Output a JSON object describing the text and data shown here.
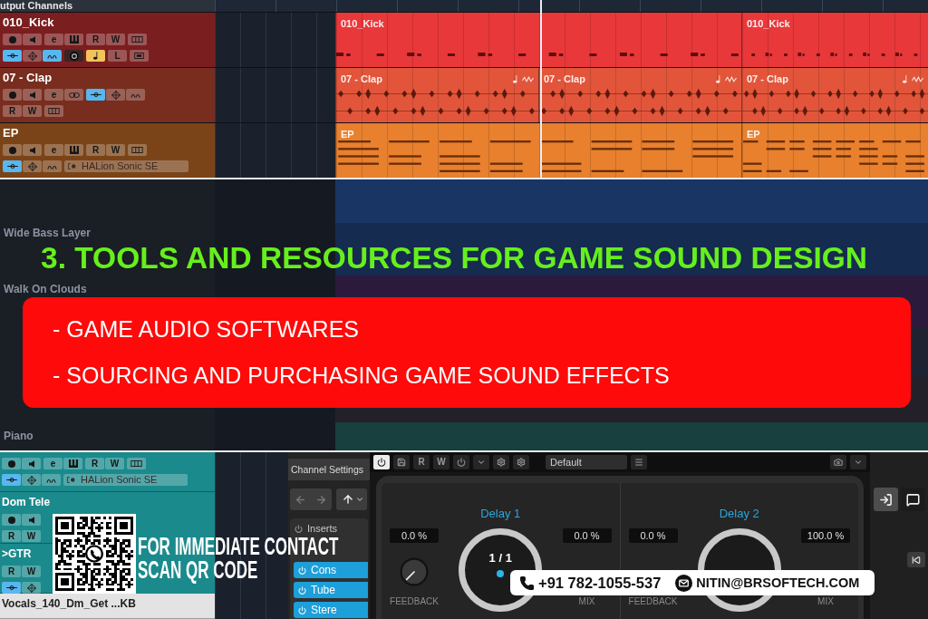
{
  "arrangement": {
    "header_label": "utput Channels",
    "top_tracks": [
      {
        "name": "010_Kick",
        "color": "#e8383a",
        "selected": false,
        "controls": [
          [
            [
              {
                "kind": "record",
                "on": false
              },
              {
                "kind": "monitor",
                "on": false
              }
            ],
            [
              {
                "kind": "label",
                "text": "e",
                "on": false
              },
              {
                "kind": "keys",
                "on": false
              }
            ],
            [
              {
                "kind": "label",
                "text": "R",
                "on": false
              },
              {
                "kind": "label",
                "text": "W",
                "on": false
              }
            ],
            [
              {
                "kind": "lanes",
                "on": false
              }
            ]
          ],
          [
            [
              {
                "kind": "input",
                "on": true
              },
              {
                "kind": "eq",
                "on": false
              },
              {
                "kind": "sends",
                "on": true
              }
            ],
            [
              {
                "kind": "disc",
                "on": false
              }
            ],
            [
              {
                "kind": "note",
                "on": true
              }
            ],
            [
              {
                "kind": "label",
                "text": "L",
                "on": false
              }
            ],
            [
              {
                "kind": "frame",
                "on": false
              }
            ]
          ]
        ],
        "clips": [
          {
            "kind": "drums",
            "label": "010_Kick"
          },
          {
            "kind": "drums",
            "label": "010_Kick"
          }
        ]
      },
      {
        "name": "07 - Clap",
        "color": "#e2553a",
        "selected": false,
        "controls": [
          [
            [
              {
                "kind": "record",
                "on": false
              },
              {
                "kind": "monitor",
                "on": false
              }
            ],
            [
              {
                "kind": "label",
                "text": "e",
                "on": false
              },
              {
                "kind": "link",
                "on": false
              }
            ],
            [
              {
                "kind": "input",
                "on": true
              },
              {
                "kind": "eq",
                "on": false
              },
              {
                "kind": "sends",
                "on": false
              }
            ]
          ],
          [
            [
              {
                "kind": "label",
                "text": "R",
                "on": false
              },
              {
                "kind": "label",
                "text": "W",
                "on": false
              }
            ],
            [
              {
                "kind": "lanes",
                "on": false
              }
            ]
          ]
        ],
        "clips": [
          {
            "kind": "audio",
            "label": "07 - Clap"
          },
          {
            "kind": "audio",
            "label": "07 - Clap"
          },
          {
            "kind": "audio",
            "label": "07 - Clap"
          }
        ]
      },
      {
        "name": "EP",
        "color": "#e8802e",
        "selected": false,
        "controls": [
          [
            [
              {
                "kind": "record",
                "on": false
              },
              {
                "kind": "monitor",
                "on": false
              }
            ],
            [
              {
                "kind": "label",
                "text": "e",
                "on": false
              },
              {
                "kind": "keys",
                "on": false
              }
            ],
            [
              {
                "kind": "label",
                "text": "R",
                "on": false
              },
              {
                "kind": "label",
                "text": "W",
                "on": false
              }
            ],
            [
              {
                "kind": "lanes",
                "on": false
              }
            ]
          ],
          [
            [
              {
                "kind": "input",
                "on": true
              },
              {
                "kind": "eq",
                "on": false
              },
              {
                "kind": "sends",
                "on": false
              }
            ],
            [
              {
                "kind": "instrument",
                "text": "HALion Sonic SE",
                "on": false
              }
            ]
          ]
        ],
        "clips": [
          {
            "kind": "midi",
            "label": "EP"
          },
          {
            "kind": "midi",
            "label": "EP"
          }
        ]
      }
    ]
  },
  "band_tracks": [
    {
      "name": "Wide Bass Layer"
    },
    {
      "name": "Walk On Clouds"
    },
    {
      "name": "Piano"
    }
  ],
  "banner": {
    "heading": "3. TOOLS AND RESOURCES FOR GAME SOUND DESIGN",
    "topics": [
      "- GAME AUDIO SOFTWARES",
      "- SOURCING AND PURCHASING GAME SOUND EFFECTS"
    ]
  },
  "bottom_tracks": [
    {
      "color": "#1b8a8c",
      "selected": false,
      "controls": [
        [
          [
            {
              "kind": "record",
              "on": false
            },
            {
              "kind": "monitor",
              "on": false
            }
          ],
          [
            {
              "kind": "label",
              "text": "e",
              "on": false
            },
            {
              "kind": "keys",
              "on": false
            }
          ],
          [
            {
              "kind": "label",
              "text": "R",
              "on": false
            },
            {
              "kind": "label",
              "text": "W",
              "on": false
            }
          ],
          [
            {
              "kind": "lanes",
              "on": false
            }
          ]
        ],
        [
          [
            {
              "kind": "input",
              "on": true
            },
            {
              "kind": "eq",
              "on": false
            },
            {
              "kind": "sends",
              "on": false
            }
          ],
          [
            {
              "kind": "instrument",
              "text": "HALion Sonic SE",
              "on": false
            }
          ]
        ]
      ]
    },
    {
      "name": "Dom Tele",
      "color": "#1b8a8c",
      "selected": false,
      "controls": [
        [
          [
            {
              "kind": "record",
              "on": false
            },
            {
              "kind": "monitor",
              "on": false
            }
          ]
        ],
        [
          [
            {
              "kind": "label",
              "text": "R",
              "on": false
            },
            {
              "kind": "label",
              "text": "W",
              "on": false
            }
          ]
        ]
      ]
    },
    {
      "name": ">GTR",
      "color": "#1b8a8c",
      "selected": false,
      "controls": [
        [
          [
            {
              "kind": "label",
              "text": "R",
              "on": false
            },
            {
              "kind": "label",
              "text": "W",
              "on": false
            }
          ]
        ],
        [
          [
            {
              "kind": "input",
              "on": true
            },
            {
              "kind": "eq",
              "on": false
            }
          ]
        ]
      ]
    },
    {
      "name": "Vocals_140_Dm_Get ...KB",
      "selected": true
    }
  ],
  "channel_settings": {
    "title": "Channel Settings",
    "inserts_label": "Inserts",
    "slots": [
      "Cons",
      "Tube",
      "Stere"
    ]
  },
  "plugin": {
    "toolbar": [
      {
        "kind": "power",
        "on": true
      },
      {
        "kind": "save",
        "on": false
      },
      {
        "kind": "label",
        "text": "R",
        "on": false
      },
      {
        "kind": "label",
        "text": "W",
        "on": false
      },
      {
        "kind": "power",
        "on": false
      },
      {
        "kind": "caret",
        "on": false
      },
      {
        "kind": "gear",
        "on": false
      },
      {
        "kind": "gear",
        "on": false
      },
      {
        "kind": "preset",
        "text": "Default"
      },
      {
        "kind": "menu",
        "on": false
      }
    ],
    "toolbar_right": [
      {
        "kind": "camera",
        "on": false
      },
      {
        "kind": "caret",
        "on": false
      }
    ],
    "sections": [
      {
        "title": "Delay 1",
        "feedback": {
          "reading": "0.0 %",
          "label": "FEEDBACK",
          "level": 0
        },
        "time": {
          "reading": "1 / 1"
        },
        "mix": {
          "reading": "0.0 %",
          "label": "MIX"
        }
      },
      {
        "title": "Delay 2",
        "feedback": {
          "reading": "0.0 %",
          "label": "FEEDBACK"
        },
        "mix": {
          "reading": "100.0 %",
          "label": "MIX"
        }
      }
    ]
  },
  "side_panel": {
    "top_buttons": [
      {
        "kind": "export"
      },
      {
        "kind": "chat"
      }
    ],
    "transport_buttons": [
      {
        "kind": "rewind"
      }
    ]
  },
  "contact": {
    "qr_caption": [
      "FOR IMMEDIATE CONTACT",
      "SCAN QR CODE"
    ],
    "phone": "+91 782-1055-537",
    "email": "NITIN@BRSOFTECH.COM"
  }
}
